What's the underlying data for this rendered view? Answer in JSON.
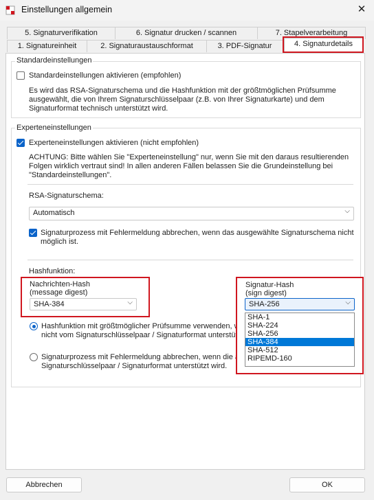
{
  "window": {
    "title": "Einstellungen allgemein",
    "close_glyph": "✕"
  },
  "tabs": {
    "row1": [
      "5. Signaturverifikation",
      "6. Signatur drucken / scannen",
      "7. Stapelverarbeitung"
    ],
    "row2": [
      "1. Signatureinheit",
      "2. Signaturaustauschformat",
      "3. PDF-Signatur",
      "4. Signaturdetails"
    ],
    "active": "4. Signaturdetails"
  },
  "standard": {
    "group_label": "Standardeinstellungen",
    "checkbox_label": "Standardeinstellungen aktivieren (empfohlen)",
    "checked": false,
    "description": [
      "Es wird das RSA-Signaturschema und die Hashfunktion mit der größtmöglichen Prüfsumme",
      "ausgewählt, die von Ihrem Signaturschlüsselpaar (z.B. von Ihrer Signaturkarte) und dem",
      "Signaturformat technisch unterstützt wird."
    ]
  },
  "expert": {
    "group_label": "Experteneinstellungen",
    "checkbox_label": "Experteneinstellungen aktivieren (nicht empfohlen)",
    "checked": true,
    "warning": [
      "ACHTUNG: Bitte wählen Sie \"Experteneinstellung\" nur, wenn Sie mit den daraus resultierenden",
      "Folgen wirklich vertraut sind! In allen anderen Fällen belassen Sie die Grundeinstellung bei",
      "\"Standardeinstellungen\"."
    ],
    "rsa_label": "RSA-Signaturschema:",
    "rsa_value": "Automatisch",
    "abort_label": [
      "Signaturprozess mit Fehlermeldung abbrechen, wenn das ausgewählte Signaturschema nicht",
      "möglich ist."
    ],
    "abort_checked": true,
    "hash_label": "Hashfunktion:",
    "message_hash_label": [
      "Nachrichten-Hash",
      "(message digest)"
    ],
    "message_hash_value": "SHA-384",
    "sign_hash_label": [
      "Signatur-Hash",
      "(sign digest)"
    ],
    "sign_hash_value": "SHA-256",
    "sign_hash_options": [
      "SHA-1",
      "SHA-224",
      "SHA-256",
      "SHA-384",
      "SHA-512",
      "RIPEMD-160"
    ],
    "sign_hash_highlighted": "SHA-384",
    "radio1": [
      "Hashfunktion mit größtmöglicher Prüfsumme verwenden, wenn d",
      "nicht vom Signaturschlüsselpaar / Signaturformat unterstützt wir"
    ],
    "radio1_checked": true,
    "radio2": [
      "Signaturprozess mit Fehlermeldung abbrechen, wenn die ausge",
      "Signaturschlüsselpaar / Signaturformat unterstützt wird."
    ],
    "radio2_checked": false
  },
  "buttons": {
    "cancel": "Abbrechen",
    "ok": "OK"
  },
  "colors": {
    "accent": "#0a63c9",
    "highlight_box": "#d0161f",
    "selection": "#0078d7"
  }
}
